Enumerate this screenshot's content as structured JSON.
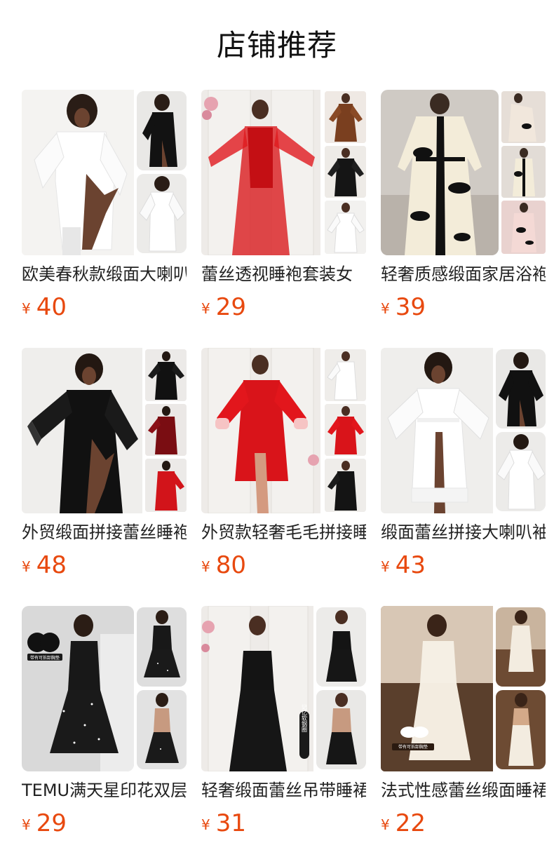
{
  "page": {
    "title": "店铺推荐",
    "currency_symbol": "¥",
    "accent_color": "#e8490f"
  },
  "products": [
    {
      "title": "欧美春秋款缎面大喇叭袖睡袍",
      "price": "40"
    },
    {
      "title": "蕾丝透视睡袍套装女",
      "price": "29"
    },
    {
      "title": "轻奢质感缎面家居浴袍",
      "price": "39"
    },
    {
      "title": "外贸缎面拼接蕾丝睡袍",
      "price": "48"
    },
    {
      "title": "外贸款轻奢毛毛拼接睡袍",
      "price": "80"
    },
    {
      "title": "缎面蕾丝拼接大喇叭袖睡袍",
      "price": "43"
    },
    {
      "title": "TEMU满天星印花双层吊带裙",
      "price": "29"
    },
    {
      "title": "轻奢缎面蕾丝吊带睡裙",
      "price": "31"
    },
    {
      "title": "法式性感蕾丝缎面睡裙",
      "price": "22"
    }
  ],
  "image_badges": {
    "card7_badge": "带有可拆卸胸垫",
    "card8_badge": "记忆软钢圈",
    "card9_badge": "带有可拆卸胸垫"
  }
}
